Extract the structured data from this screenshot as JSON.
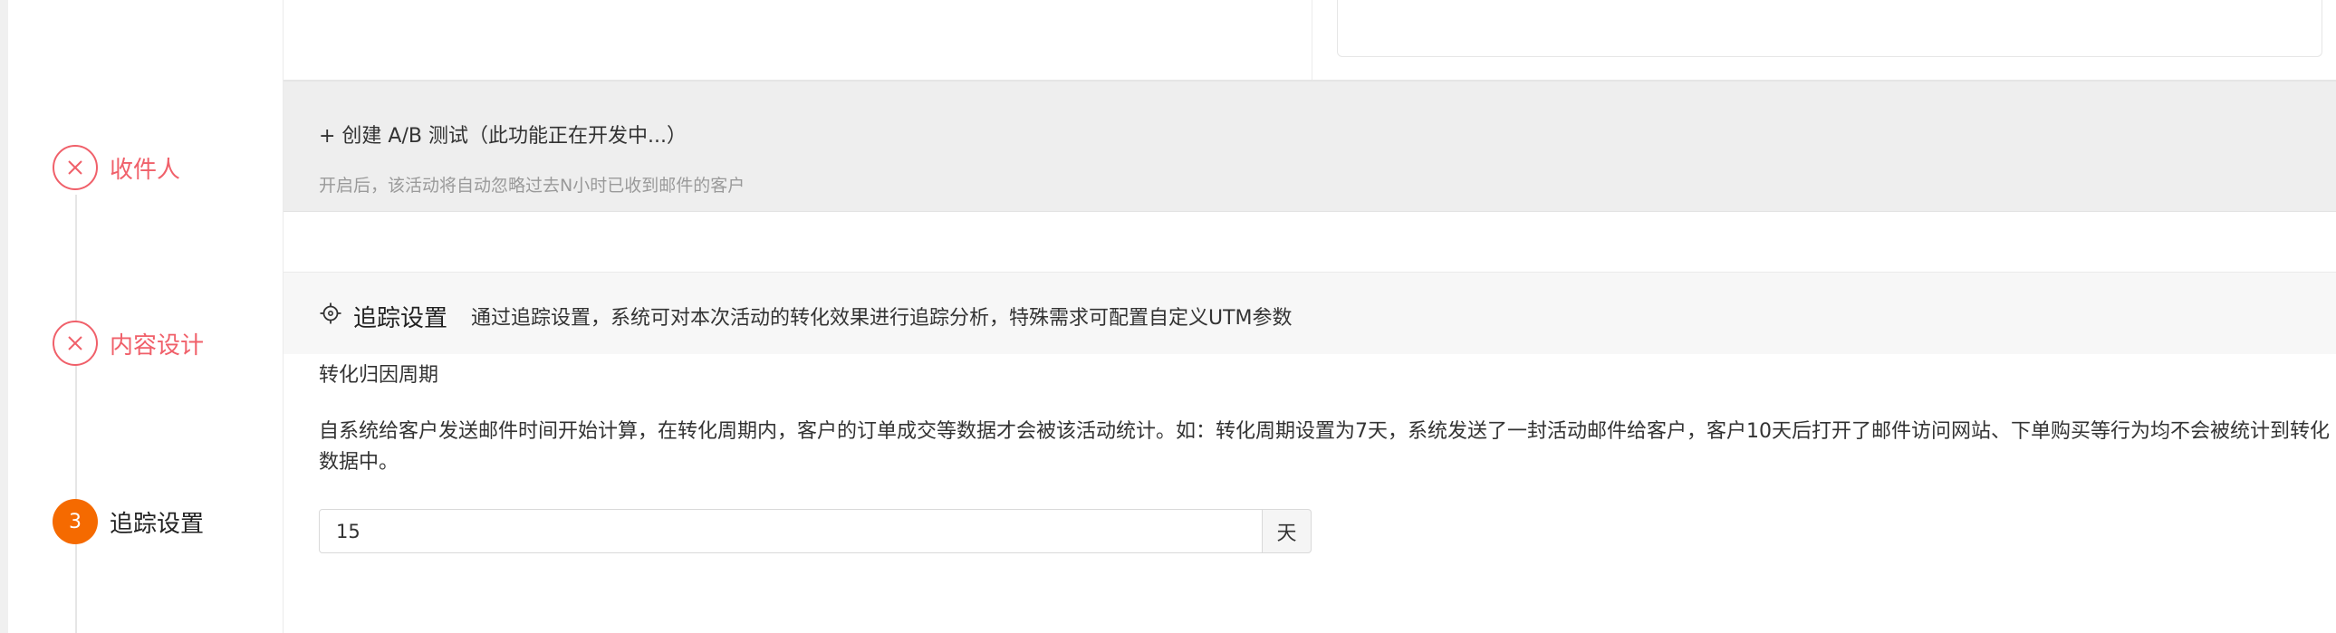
{
  "steps": [
    {
      "label": "收件人",
      "status": "error"
    },
    {
      "label": "内容设计",
      "status": "error"
    },
    {
      "label": "追踪设置",
      "status": "active",
      "number": "3"
    }
  ],
  "ab_test": {
    "link": "+ 创建 A/B 测试（此功能正在开发中...）",
    "hint": "开启后，该活动将自动忽略过去N小时已收到邮件的客户"
  },
  "tracking": {
    "title": "追踪设置",
    "description": "通过追踪设置，系统可对本次活动的转化效果进行追踪分析，特殊需求可配置自定义UTM参数"
  },
  "conversion": {
    "label": "转化归因周期",
    "description": "自系统给客户发送邮件时间开始计算，在转化周期内，客户的订单成交等数据才会被该活动统计。如：转化周期设置为7天，系统发送了一封活动邮件给客户，客户10天后打开了邮件访问网站、下单购买等行为均不会被统计到转化数据中。",
    "value": "15",
    "unit": "天"
  },
  "colors": {
    "error": "#f0606a",
    "active": "#f56a00"
  },
  "icons": {
    "error_step": "close-icon",
    "tracking": "target-icon"
  }
}
